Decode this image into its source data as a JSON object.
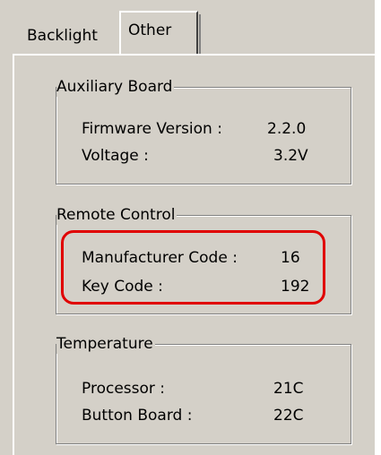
{
  "tabs": [
    {
      "label": "Backlight",
      "selected": false
    },
    {
      "label": "Other",
      "selected": true
    }
  ],
  "groups": {
    "auxiliary_board": {
      "title": "Auxiliary Board",
      "rows": [
        {
          "label": "Firmware Version :",
          "value": "2.2.0"
        },
        {
          "label": "Voltage :",
          "value": "3.2V"
        }
      ]
    },
    "remote_control": {
      "title": "Remote Control",
      "rows": [
        {
          "label": "Manufacturer Code :",
          "value": "16"
        },
        {
          "label": "Key Code :",
          "value": "192"
        }
      ]
    },
    "temperature": {
      "title": "Temperature",
      "rows": [
        {
          "label": "Processor :",
          "value": "21C"
        },
        {
          "label": "Button Board :",
          "value": "22C"
        }
      ]
    }
  },
  "colors": {
    "window_bg": "#d4d0c8",
    "highlight": "#e00000"
  }
}
